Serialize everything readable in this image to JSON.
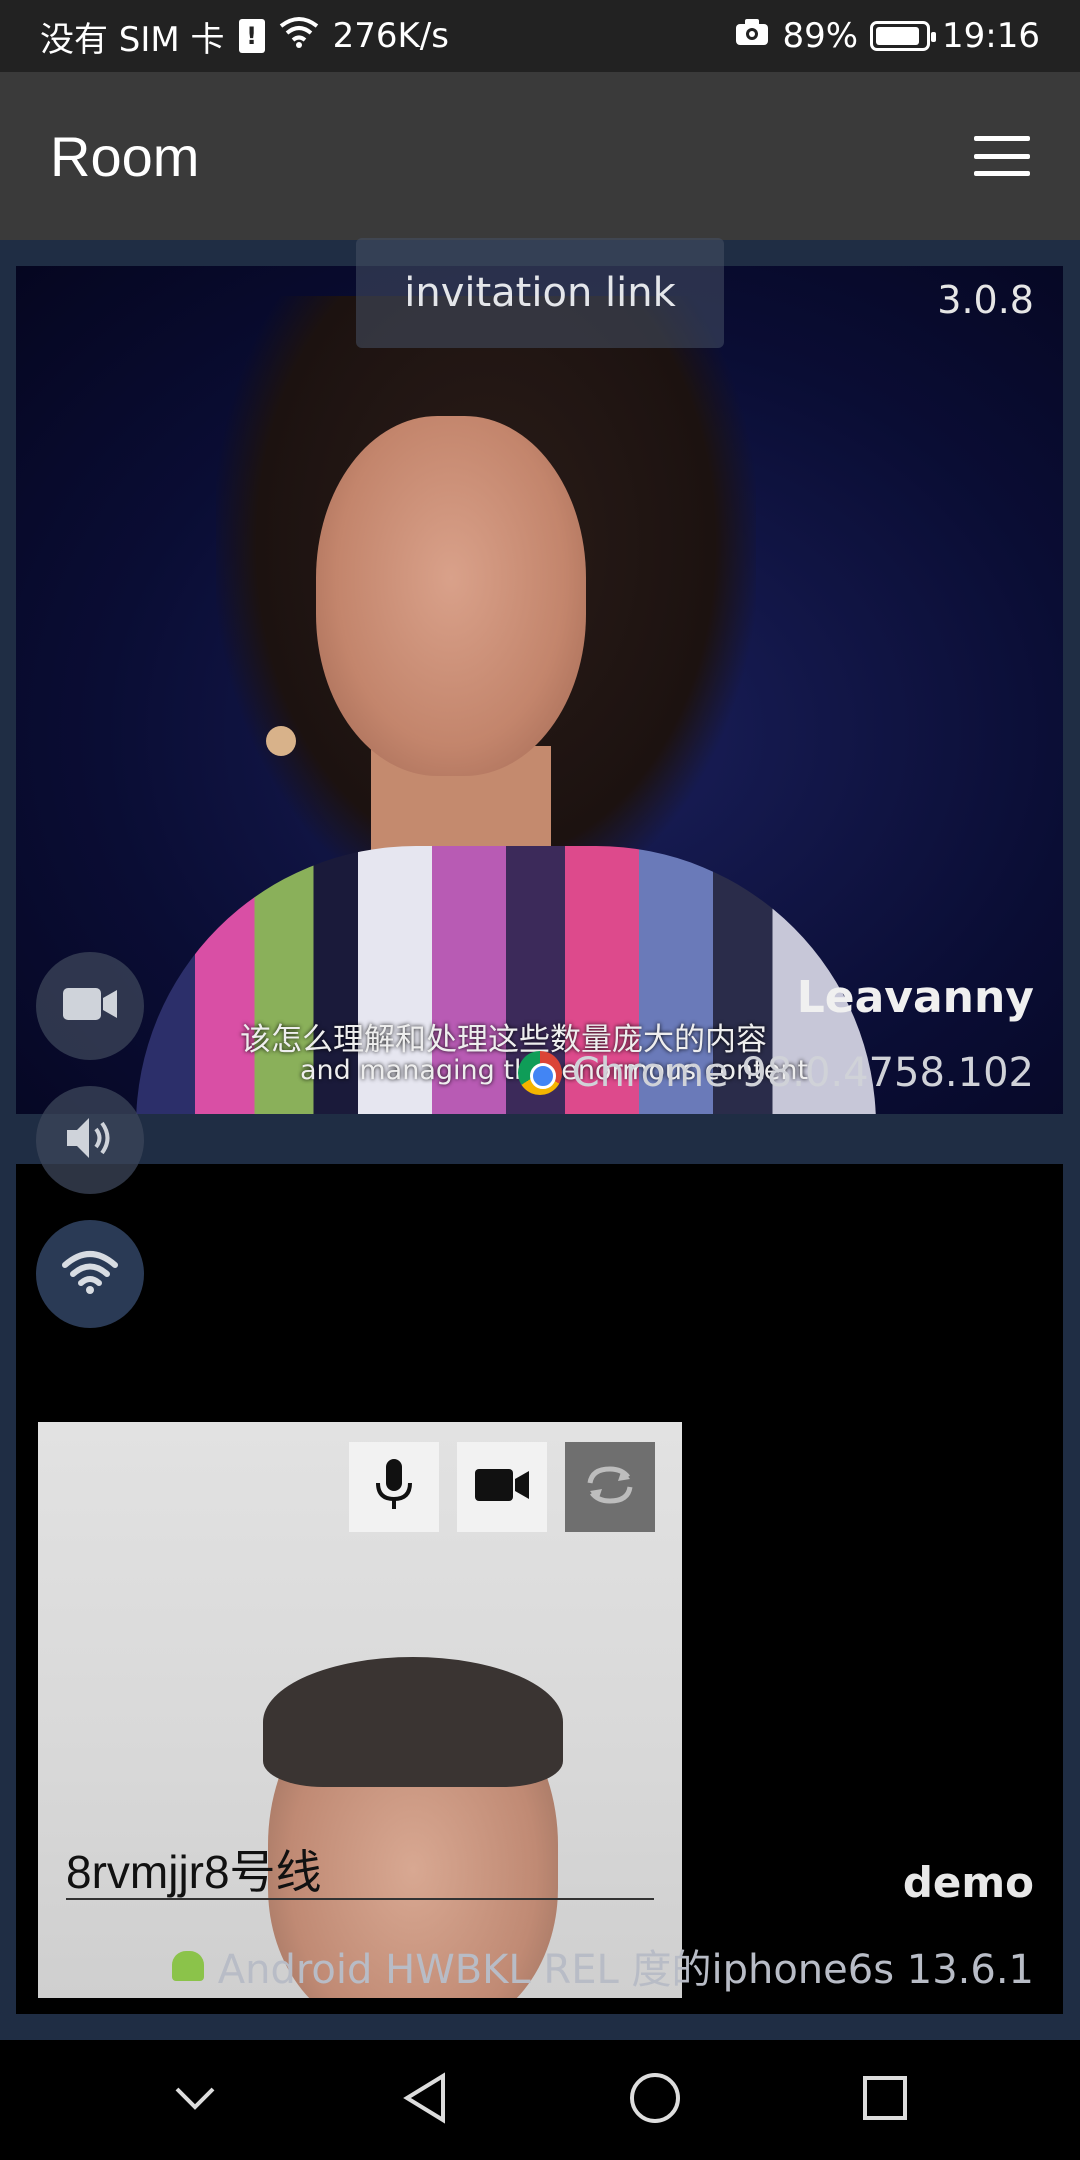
{
  "status_bar": {
    "carrier": "没有 SIM 卡",
    "sim_badge": "!",
    "network_speed": "276K/s",
    "battery_percent": "89%",
    "battery_level": 0.89,
    "time": "19:16"
  },
  "app_bar": {
    "title": "Room"
  },
  "remote": {
    "invite_label": "invitation link",
    "version": "3.0.8",
    "user_name": "Leavanny",
    "subtitle_cn": "该怎么理解和处理这些数量庞大的内容",
    "subtitle_en": "and managing this enormous content",
    "browser": "Chrome 98.0.4758.102"
  },
  "side_controls": {
    "icons": [
      "video-camera-icon",
      "speaker-icon",
      "wifi-icon"
    ]
  },
  "local": {
    "name_value": "8rvmjjr8号线",
    "user_name": "demo",
    "device": "Android HWBKL REL 度的iphone6s 13.6.1",
    "controls": [
      "microphone-icon",
      "camera-icon",
      "switch-camera-icon"
    ]
  },
  "nav_bar": {
    "icons": [
      "collapse-icon",
      "back-icon",
      "home-icon",
      "recents-icon"
    ]
  }
}
